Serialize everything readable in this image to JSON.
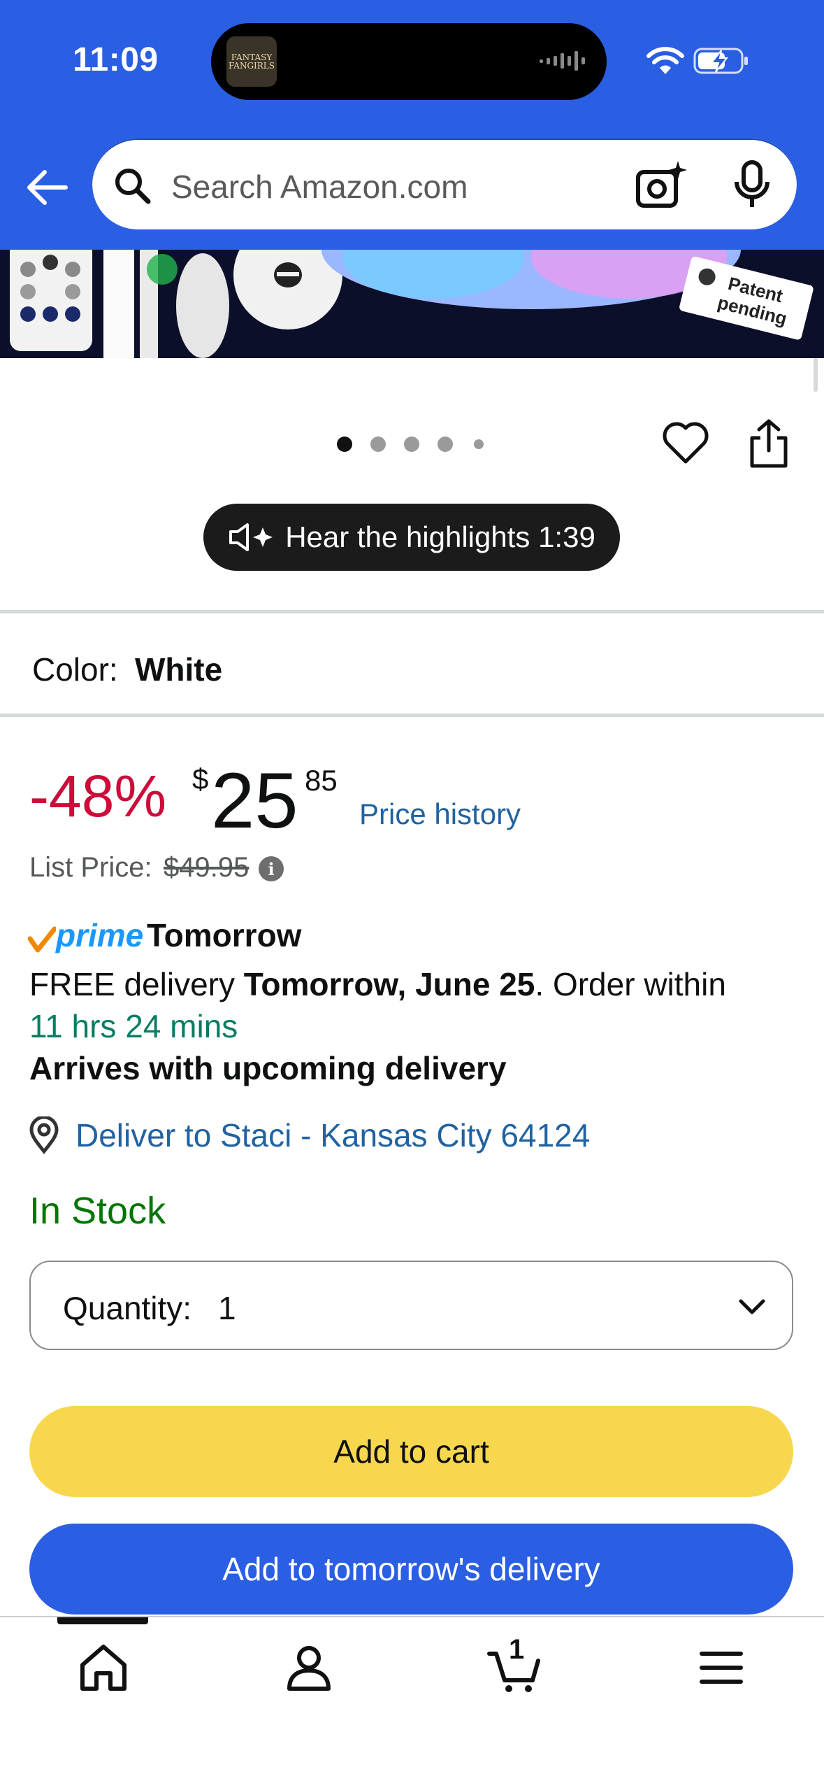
{
  "status_bar": {
    "time": "11:09",
    "island_logo_text": "FANTASY FANGIRLS"
  },
  "search": {
    "placeholder": "Search Amazon.com"
  },
  "hero": {
    "badge_text": "Patent pending"
  },
  "carousel": {
    "dot_count": 5,
    "active_index": 0
  },
  "highlights": {
    "label": "Hear the highlights 1:39"
  },
  "color": {
    "label": "Color:",
    "value": "White"
  },
  "price": {
    "discount": "-48%",
    "currency": "$",
    "whole": "25",
    "fraction": "85",
    "history_link": "Price history",
    "list_label": "List Price:",
    "list_value": "$49.95"
  },
  "delivery": {
    "prime_word": "prime",
    "prime_day": "Tomorrow",
    "free_prefix": "FREE delivery ",
    "free_date": "Tomorrow, June 25",
    "free_suffix": ". Order within",
    "countdown": "11 hrs 24 mins",
    "arrives": "Arrives with upcoming delivery",
    "deliver_to": "Deliver to Staci - Kansas City 64124"
  },
  "stock": {
    "status": "In Stock"
  },
  "quantity": {
    "label": "Quantity:",
    "value": "1"
  },
  "buttons": {
    "add_to_cart": "Add to cart",
    "add_to_tomorrow": "Add to tomorrow's delivery"
  },
  "bottom_nav": {
    "cart_count": "1",
    "items": [
      "home-icon",
      "account-icon",
      "cart-icon",
      "menu-icon"
    ]
  },
  "colors": {
    "header_blue": "#2a5ee3",
    "discount_red": "#cc0c39",
    "link_blue": "#2162a1",
    "stock_green": "#007600",
    "cart_yellow": "#f7d74e",
    "countdown_green": "#067d62"
  }
}
